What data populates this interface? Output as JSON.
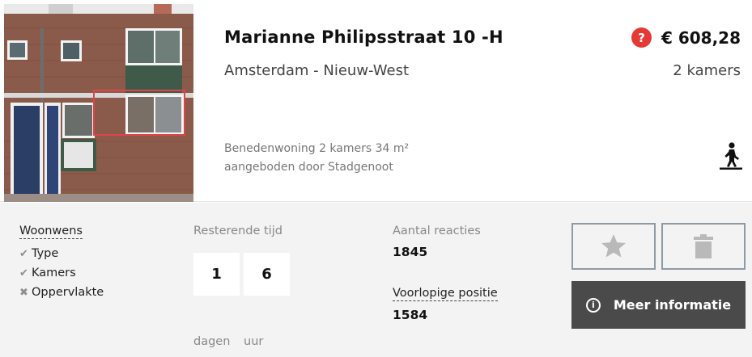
{
  "listing": {
    "address": "Marianne Philipsstraat 10 -H",
    "location": "Amsterdam - Nieuw-West",
    "price": "€ 608,28",
    "price_help_symbol": "?",
    "rooms": "2 kamers",
    "description_line1": "Benedenwoning 2 kamers 34 m²",
    "description_line2": "aangeboden door Stadgenoot",
    "icons": {
      "price_help": "help-icon",
      "accessibility": "accessible-walking-icon"
    }
  },
  "wishes": {
    "title": "Woonwens",
    "items": [
      {
        "mark": "✔",
        "label": "Type",
        "status": "match"
      },
      {
        "mark": "✔",
        "label": "Kamers",
        "status": "match"
      },
      {
        "mark": "✖",
        "label": "Oppervlakte",
        "status": "no-match"
      }
    ]
  },
  "remaining_time": {
    "label": "Resterende tijd",
    "days_value": "1",
    "hours_value": "6",
    "days_unit": "dagen",
    "hours_unit": "uur"
  },
  "stats": {
    "reactions_label": "Aantal reacties",
    "reactions_value": "1845",
    "position_label": "Voorlopige positie",
    "position_value": "1584"
  },
  "actions": {
    "favorite_icon": "star-icon",
    "delete_icon": "trash-icon",
    "more_info_label": "Meer informatie",
    "more_info_icon": "info-icon"
  },
  "colors": {
    "accent_red": "#e53935",
    "button_dark": "#4a4a4a",
    "panel_bg": "#f3f3f3",
    "button_border": "#8e9aa4",
    "icon_gray": "#b9b9b9"
  }
}
